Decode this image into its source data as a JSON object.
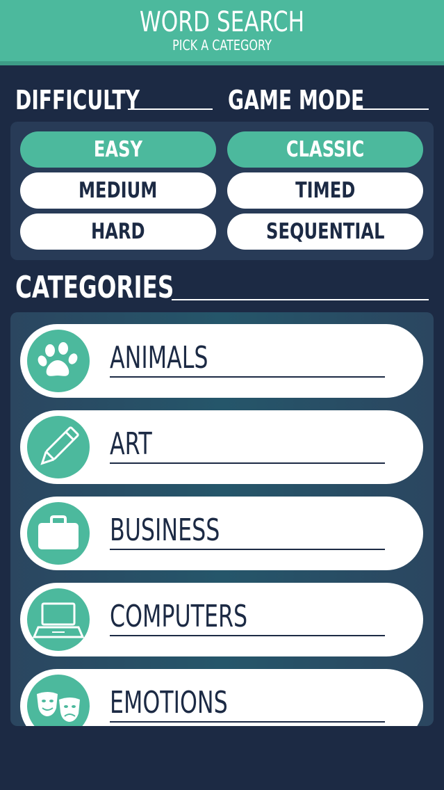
{
  "header": {
    "title": "WORD SEARCH",
    "subtitle": "PICK A CATEGORY"
  },
  "difficulty": {
    "label": "DIFFICULTY",
    "options": [
      {
        "label": "EASY",
        "selected": true
      },
      {
        "label": "MEDIUM",
        "selected": false
      },
      {
        "label": "HARD",
        "selected": false
      }
    ]
  },
  "game_mode": {
    "label": "GAME MODE",
    "options": [
      {
        "label": "CLASSIC",
        "selected": true
      },
      {
        "label": "TIMED",
        "selected": false
      },
      {
        "label": "SEQUENTIAL",
        "selected": false
      }
    ]
  },
  "categories": {
    "label": "CATEGORIES",
    "items": [
      {
        "label": "ANIMALS",
        "icon": "paw-icon"
      },
      {
        "label": "ART",
        "icon": "pencil-icon"
      },
      {
        "label": "BUSINESS",
        "icon": "briefcase-icon"
      },
      {
        "label": "COMPUTERS",
        "icon": "laptop-icon"
      },
      {
        "label": "EMOTIONS",
        "icon": "theater-masks-icon"
      }
    ]
  },
  "colors": {
    "accent": "#4cb99d",
    "background": "#1c2a44",
    "panel": "#283b57",
    "text_dark": "#1c2a44",
    "white": "#ffffff"
  }
}
